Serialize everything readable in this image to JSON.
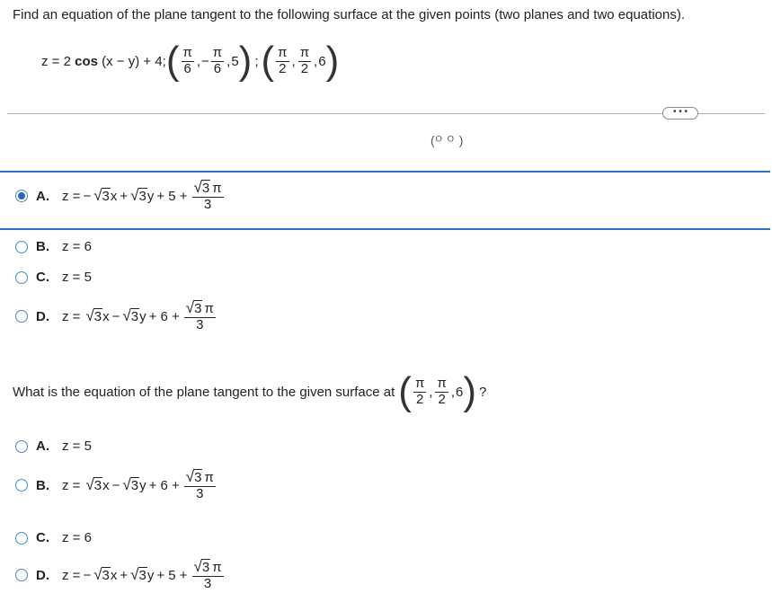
{
  "instructions": "Find an equation of the plane tangent to the following surface at the given points (two planes and two equations).",
  "surface": {
    "lhs": "z = 2",
    "func": "cos",
    "arg": "(x − y) + 4;",
    "p1": {
      "x_num": "π",
      "x_den": "6",
      "y_sign": "−",
      "y_num": "π",
      "y_den": "6",
      "z": "5"
    },
    "sep": ";",
    "p2": {
      "x_num": "π",
      "x_den": "2",
      "y_num": "π",
      "y_den": "2",
      "z": "6"
    }
  },
  "more_button": "• • •",
  "partial_artifact": "(ᴼ   ᴼ )",
  "q1": {
    "options": [
      {
        "letter": "A.",
        "selected": true,
        "kind": "eq",
        "z": "z =",
        "s1": "−",
        "t1": "x",
        "s2": "+",
        "t2": "y",
        "c": "+ 5 +",
        "frac_num": "π",
        "frac_den": "3"
      },
      {
        "letter": "B.",
        "selected": false,
        "kind": "simple",
        "text": "z = 6"
      },
      {
        "letter": "C.",
        "selected": false,
        "kind": "simple",
        "text": "z = 5"
      },
      {
        "letter": "D.",
        "selected": false,
        "kind": "eq",
        "z": "z =",
        "s1": "",
        "t1": "x",
        "s2": "−",
        "t2": "y",
        "c": "+ 6 +",
        "frac_num": "π",
        "frac_den": "3"
      }
    ]
  },
  "q2": {
    "prompt": "What is the equation of the plane tangent to the given surface at",
    "point": {
      "x_num": "π",
      "x_den": "2",
      "y_num": "π",
      "y_den": "2",
      "z": "6"
    },
    "qmark": "?",
    "options": [
      {
        "letter": "A.",
        "selected": false,
        "kind": "simple",
        "text": "z = 5"
      },
      {
        "letter": "B.",
        "selected": false,
        "kind": "eq",
        "z": "z =",
        "s1": "",
        "t1": "x",
        "s2": "−",
        "t2": "y",
        "c": "+ 6 +",
        "frac_num": "π",
        "frac_den": "3"
      },
      {
        "letter": "C.",
        "selected": false,
        "kind": "simple",
        "text": "z = 6"
      },
      {
        "letter": "D.",
        "selected": false,
        "kind": "eq",
        "z": "z =",
        "s1": "−",
        "t1": "x",
        "s2": "+",
        "t2": "y",
        "c": "+ 5 +",
        "frac_num": "π",
        "frac_den": "3"
      }
    ]
  },
  "sqrt_radicand": "3",
  "colors": {
    "accent": "#2a73c5",
    "radio": "#4a87c7",
    "divider": "#b0b0b0"
  }
}
